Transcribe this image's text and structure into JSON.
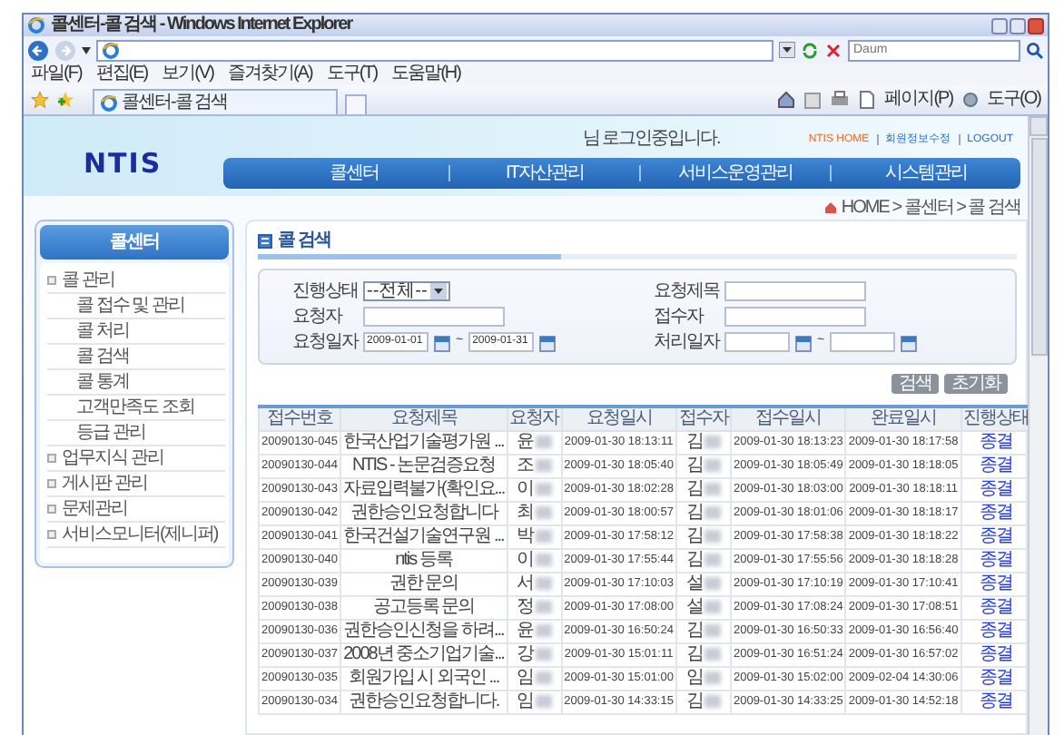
{
  "browser": {
    "title": "콜센터-콜 검색 - Windows Internet Explorer",
    "search_placeholder": "Daum",
    "menu": [
      "파일(F)",
      "편집(E)",
      "보기(V)",
      "즐겨찾기(A)",
      "도구(T)",
      "도움말(H)"
    ],
    "tab": "콜센터-콜 검색",
    "tools": [
      "페이지(P)",
      "도구(O)"
    ]
  },
  "header": {
    "logo": "NTIS",
    "login_message": "님 로그인중입니다.",
    "links": [
      "NTIS HOME",
      "회원정보수정",
      "LOGOUT"
    ],
    "nav": [
      "콜센터",
      "IT자산관리",
      "서비스운영관리",
      "시스템관리"
    ]
  },
  "breadcrumb": "HOME > 콜센터 > 콜 검색",
  "sidebar": {
    "title": "콜센터",
    "items": [
      {
        "label": "콜 관리",
        "children": [
          {
            "label": "콜 접수 및 관리"
          },
          {
            "label": "콜 처리"
          },
          {
            "label": "콜 검색"
          },
          {
            "label": "콜 통계"
          },
          {
            "label": "고객만족도 조회"
          },
          {
            "label": "등급 관리"
          }
        ]
      },
      {
        "label": "업무지식 관리"
      },
      {
        "label": "게시판 관리"
      },
      {
        "label": "문제관리"
      },
      {
        "label": "서비스모니터(제니퍼)"
      }
    ]
  },
  "page_title": "콜 검색",
  "filters": [
    {
      "label": "진행상태",
      "kind": "select",
      "value": "--전체--"
    },
    {
      "label": "요청제목",
      "kind": "text"
    },
    {
      "label": "요청자",
      "kind": "text"
    },
    {
      "label": "접수자",
      "kind": "text"
    },
    {
      "label": "요청일자",
      "kind": "date_range",
      "from": "2009-01-01",
      "to": "2009-01-31",
      "separator": "~"
    },
    {
      "label": "처리일자",
      "kind": "date_range",
      "separator": "~"
    }
  ],
  "buttons": [
    "검색",
    "초기화"
  ],
  "table": {
    "columns": [
      "접수번호",
      "요청제목",
      "요청자",
      "요청일시",
      "접수자",
      "접수일시",
      "완료일시",
      "진행상태"
    ],
    "rows": [
      {
        "number": "20090130-045",
        "title": "한국산업기술평가원 ...",
        "requester": "윤",
        "requested_at": "2009-01-30 18:13:11",
        "receiver": "김",
        "received_at": "2009-01-30 18:13:23",
        "completed_at": "2009-01-30 18:17:58",
        "status": "종결"
      },
      {
        "number": "20090130-044",
        "title": "NTIS - 논문검증요청",
        "requester": "조",
        "requested_at": "2009-01-30 18:05:40",
        "receiver": "김",
        "received_at": "2009-01-30 18:05:49",
        "completed_at": "2009-01-30 18:18:05",
        "status": "종결"
      },
      {
        "number": "20090130-043",
        "title": "자료입력불가(확인요...",
        "requester": "이",
        "requested_at": "2009-01-30 18:02:28",
        "receiver": "김",
        "received_at": "2009-01-30 18:03:00",
        "completed_at": "2009-01-30 18:18:11",
        "status": "종결"
      },
      {
        "number": "20090130-042",
        "title": "권한승인요청합니다",
        "requester": "최",
        "requested_at": "2009-01-30 18:00:57",
        "receiver": "김",
        "received_at": "2009-01-30 18:01:06",
        "completed_at": "2009-01-30 18:18:17",
        "status": "종결"
      },
      {
        "number": "20090130-041",
        "title": "한국건설기술연구원 ...",
        "requester": "박",
        "requested_at": "2009-01-30 17:58:12",
        "receiver": "김",
        "received_at": "2009-01-30 17:58:38",
        "completed_at": "2009-01-30 18:18:22",
        "status": "종결"
      },
      {
        "number": "20090130-040",
        "title": "ntis 등록",
        "requester": "이",
        "requested_at": "2009-01-30 17:55:44",
        "receiver": "김",
        "received_at": "2009-01-30 17:55:56",
        "completed_at": "2009-01-30 18:18:28",
        "status": "종결"
      },
      {
        "number": "20090130-039",
        "title": "권한 문의",
        "requester": "서",
        "requested_at": "2009-01-30 17:10:03",
        "receiver": "설",
        "received_at": "2009-01-30 17:10:19",
        "completed_at": "2009-01-30 17:10:41",
        "status": "종결"
      },
      {
        "number": "20090130-038",
        "title": "공고등록 문의",
        "requester": "정",
        "requested_at": "2009-01-30 17:08:00",
        "receiver": "설",
        "received_at": "2009-01-30 17:08:24",
        "completed_at": "2009-01-30 17:08:51",
        "status": "종결"
      },
      {
        "number": "20090130-036",
        "title": "권한승인신청을 하려...",
        "requester": "윤",
        "requested_at": "2009-01-30 16:50:24",
        "receiver": "김",
        "received_at": "2009-01-30 16:50:33",
        "completed_at": "2009-01-30 16:56:40",
        "status": "종결"
      },
      {
        "number": "20090130-037",
        "title": "2008년 중소기업기술...",
        "requester": "강",
        "requested_at": "2009-01-30 15:01:11",
        "receiver": "김",
        "received_at": "2009-01-30 16:51:24",
        "completed_at": "2009-01-30 16:57:02",
        "status": "종결"
      },
      {
        "number": "20090130-035",
        "title": "회원가입 시 외국인 ...",
        "requester": "임",
        "requested_at": "2009-01-30 15:01:00",
        "receiver": "임",
        "received_at": "2009-01-30 15:02:00",
        "completed_at": "2009-02-04 14:30:06",
        "status": "종결"
      },
      {
        "number": "20090130-034",
        "title": "권한승인요청합니다.",
        "requester": "임",
        "requested_at": "2009-01-30 14:33:15",
        "receiver": "김",
        "received_at": "2009-01-30 14:33:25",
        "completed_at": "2009-01-30 14:52:18",
        "status": "종결"
      }
    ]
  }
}
